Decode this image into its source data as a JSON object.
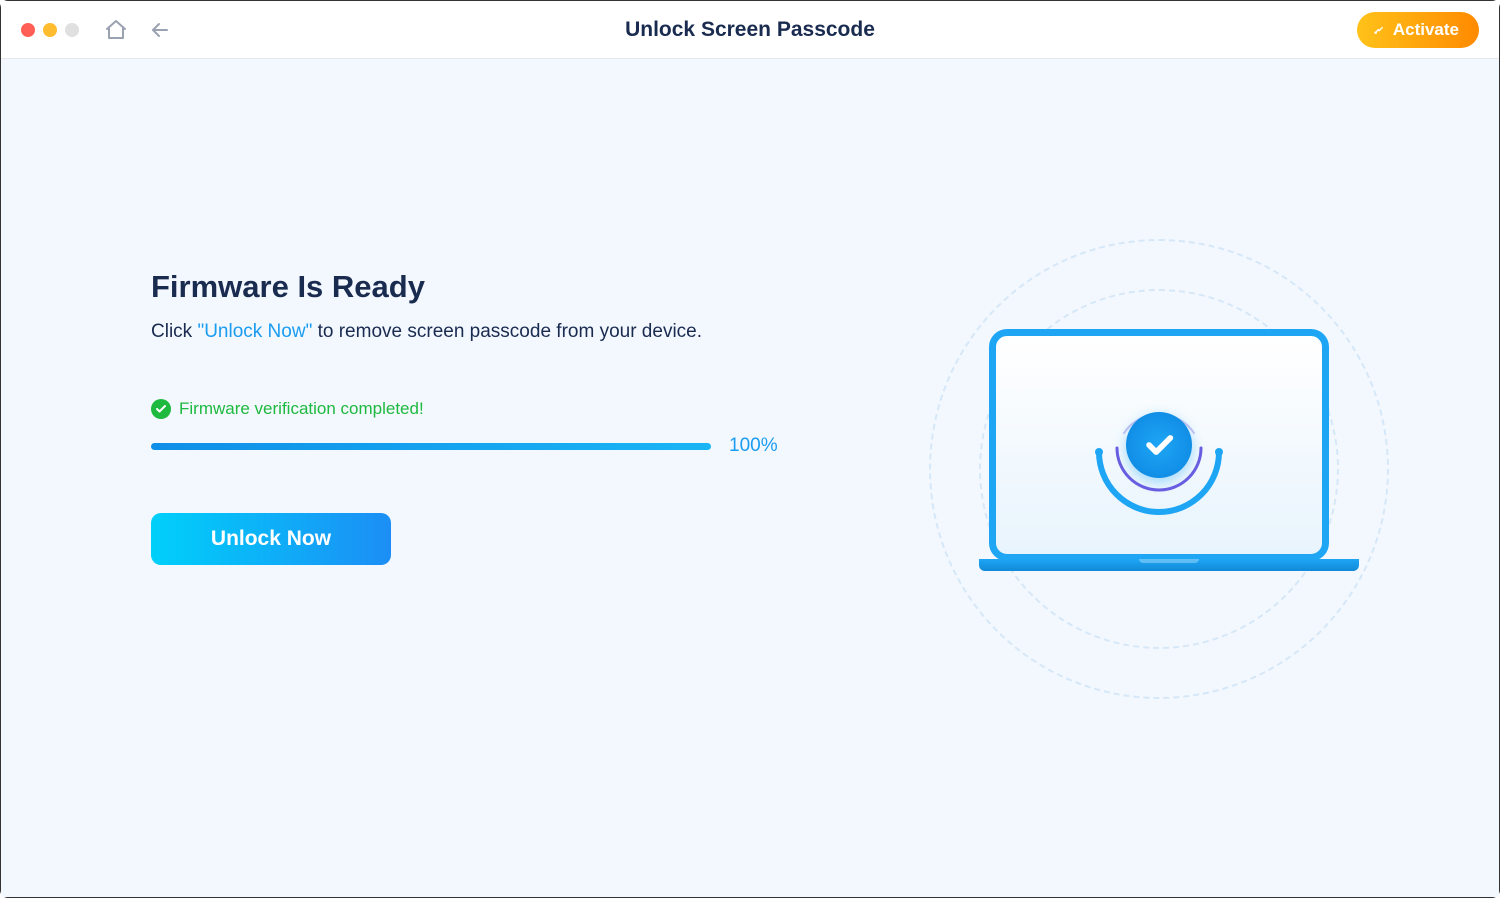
{
  "header": {
    "title": "Unlock Screen Passcode",
    "activate_label": "Activate"
  },
  "main": {
    "heading": "Firmware Is Ready",
    "sub_prefix": "Click ",
    "sub_quote_open": "\"",
    "sub_highlight": "Unlock Now",
    "sub_quote_close": "\"",
    "sub_suffix": " to remove screen passcode from your device.",
    "verification_text": "Firmware verification completed!",
    "progress_percent": "100%",
    "unlock_label": "Unlock Now"
  }
}
